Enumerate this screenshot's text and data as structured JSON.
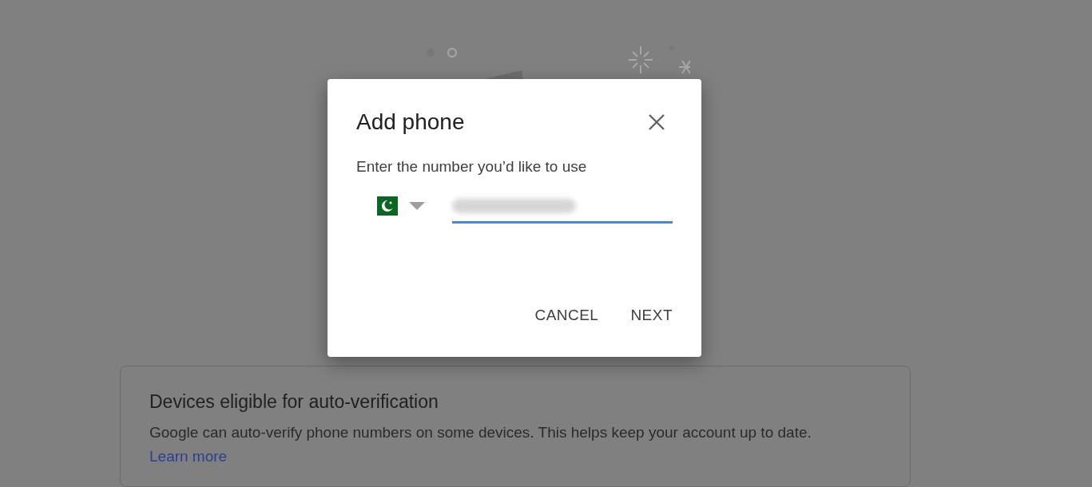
{
  "page": {
    "card": {
      "title": "Devices eligible for auto-verification",
      "body": "Google can auto-verify phone numbers on some devices. This helps keep your account up to date.",
      "link": "Learn more"
    }
  },
  "dialog": {
    "title": "Add phone",
    "prompt": "Enter the number you’d like to use",
    "buttons": [
      "CANCEL",
      "NEXT"
    ]
  }
}
